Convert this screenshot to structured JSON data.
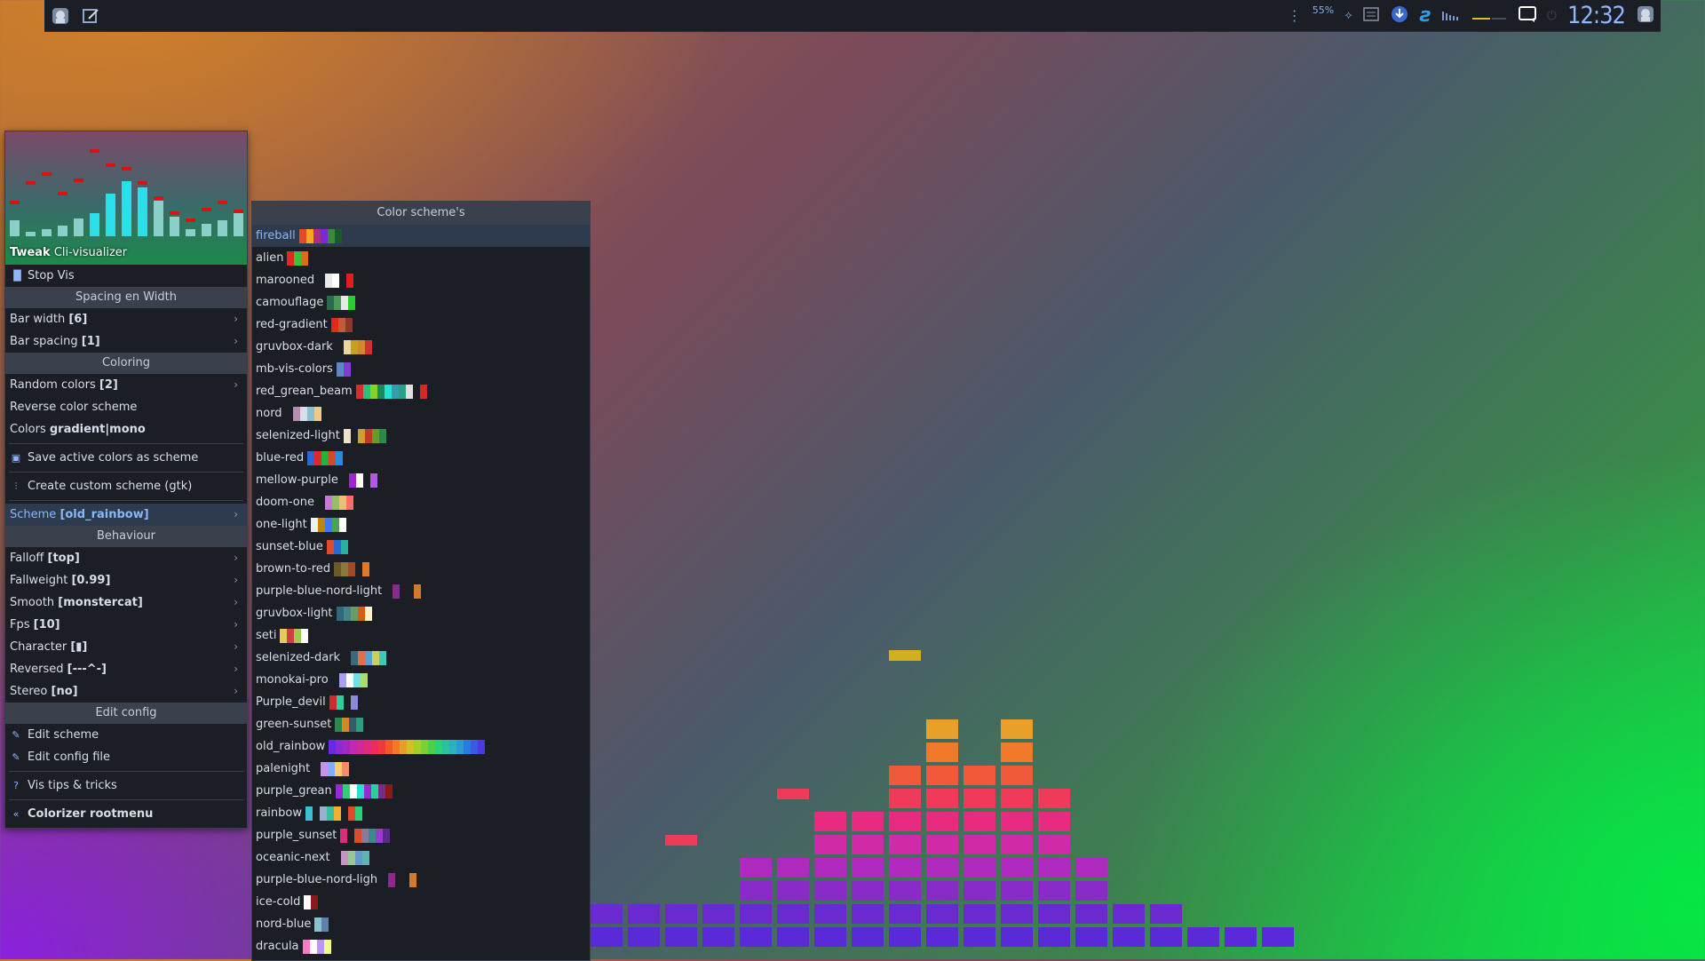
{
  "panel": {
    "battery_percent": "55%",
    "clock": "12:32",
    "icons": [
      "app-menu-icon",
      "editor-icon",
      "kebab-icon",
      "network-icon",
      "clipboard-icon",
      "update-icon",
      "script-icon",
      "volume-bars-icon",
      "battery-line-icon",
      "notification-icon",
      "power-icon",
      "user-icon"
    ]
  },
  "preview": {
    "title_bold": "Tweak",
    "title_rest": "Cli-visualizer"
  },
  "menu": {
    "stop_vis": "Stop Vis",
    "spacing_header": "Spacing en Width",
    "bar_width_label": "Bar width ",
    "bar_width_value": "[6]",
    "bar_spacing_label": "Bar spacing ",
    "bar_spacing_value": "[1]",
    "coloring_header": "Coloring",
    "random_colors_label": "Random colors ",
    "random_colors_value": "[2]",
    "reverse_scheme": "Reverse color scheme",
    "colors_label": "Colors ",
    "colors_value": "gradient|mono",
    "save_active": "Save active colors as scheme",
    "create_custom": "Create custom scheme (gtk)",
    "scheme_label": "Scheme ",
    "scheme_value": "[old_rainbow]",
    "behaviour_header": "Behaviour",
    "falloff_label": "Falloff ",
    "falloff_value": "[top]",
    "fallweight_label": "Fallweight ",
    "fallweight_value": "[0.99]",
    "smooth_label": "Smooth ",
    "smooth_value": "[monstercat]",
    "fps_label": "Fps ",
    "fps_value": "[10]",
    "character_label": "Character ",
    "character_value": "[▮]",
    "reversed_label": "Reversed ",
    "reversed_value": "[---^-]",
    "stereo_label": "Stereo ",
    "stereo_value": "[no]",
    "edit_config_header": "Edit config",
    "edit_scheme": "Edit scheme",
    "edit_config_file": "Edit config file",
    "vis_tips": "Vis tips & tricks",
    "colorizer_label": "Colorizer rootmenu"
  },
  "submenu": {
    "header": "Color scheme's",
    "schemes": [
      {
        "name": "fireball",
        "colors": [
          "#e34a2a",
          "#f5a623",
          "#b02a8a",
          "#7a2ad0",
          "#3a8a3a",
          "#1a5a2a"
        ]
      },
      {
        "name": "alien",
        "colors": [
          "#e02a1a",
          "#3ac03a",
          "#e06a1a"
        ]
      },
      {
        "name": "marooned",
        "colors": [
          "#1b1e24",
          "#e8e8e8",
          "#ffffff",
          "#1b1e24",
          "#e02020"
        ]
      },
      {
        "name": "camouflage",
        "colors": [
          "#2a6a4a",
          "#4a9a5a",
          "#e8e8e8",
          "#2ad02a"
        ]
      },
      {
        "name": "red-gradient",
        "colors": [
          "#e02a1a",
          "#c05a3a",
          "#8a3a2a"
        ]
      },
      {
        "name": "gruvbox-dark",
        "colors": [
          "#1b1e24",
          "#e8d8a0",
          "#c8a020",
          "#d08a2a",
          "#d03030"
        ]
      },
      {
        "name": "mb-vis-colors",
        "colors": [
          "#5a8ac0",
          "#8a3ad0"
        ]
      },
      {
        "name": "red_grean_beam",
        "colors": [
          "#d03030",
          "#2ac07a",
          "#8ad02a",
          "#1a8a5a",
          "#2ae0d0",
          "#3a9ab0",
          "#2aa08a",
          "#e0e0e0",
          "#1b1e24",
          "#d02a2a"
        ]
      },
      {
        "name": "nord",
        "colors": [
          "#1b1e24",
          "#b48ead",
          "#d8dee9",
          "#88c0d0",
          "#ebcb8b"
        ]
      },
      {
        "name": "selenized-light",
        "colors": [
          "#ece3cc",
          "#1b1e24",
          "#d2a02a",
          "#c03a2a",
          "#6a9a2a",
          "#2a8a4a"
        ]
      },
      {
        "name": "blue-red",
        "colors": [
          "#2a6ad0",
          "#e02a2a",
          "#2ab03a",
          "#d04a2a",
          "#2a8ae0"
        ]
      },
      {
        "name": "mellow-purple",
        "colors": [
          "#1b1e24",
          "#9a2ad0",
          "#ffffff",
          "#1b1e24",
          "#b05ae0"
        ]
      },
      {
        "name": "doom-one",
        "colors": [
          "#1b1e24",
          "#c678dd",
          "#98be65",
          "#ecbe7b",
          "#ff6c6b"
        ]
      },
      {
        "name": "one-light",
        "colors": [
          "#f0f0f0",
          "#c18401",
          "#4078f2",
          "#50a14f",
          "#ffffff"
        ]
      },
      {
        "name": "sunset-blue",
        "colors": [
          "#e04a2a",
          "#2a6ad0",
          "#2ab0a0"
        ]
      },
      {
        "name": "brown-to-red",
        "colors": [
          "#6a5a2a",
          "#8a7a3a",
          "#a04a2a",
          "#1b1e24",
          "#e07a2a"
        ]
      },
      {
        "name": "purple-blue-nord-light",
        "colors": [
          "#1b1e24",
          "#8a2a8a",
          "#1b1e24",
          "#1b1e24",
          "#d07a2a"
        ]
      },
      {
        "name": "gruvbox-light",
        "colors": [
          "#2a6a7a",
          "#458588",
          "#689d6a",
          "#d65d0e",
          "#fbf1c7"
        ]
      },
      {
        "name": "seti",
        "colors": [
          "#e8c85a",
          "#cd3f45",
          "#9fca56",
          "#ffffff"
        ]
      },
      {
        "name": "selenized-dark",
        "colors": [
          "#1b1e24",
          "#3a6a7a",
          "#e0704a",
          "#58a0d0",
          "#c8d060",
          "#41c7b9"
        ]
      },
      {
        "name": "monokai-pro",
        "colors": [
          "#1b1e24",
          "#ab9df2",
          "#ffffff",
          "#78dce8",
          "#a9dc76"
        ]
      },
      {
        "name": "Purple_devil",
        "colors": [
          "#d02a2a",
          "#2ad0a0",
          "#1b1e24",
          "#8a8ae0"
        ]
      },
      {
        "name": "green-sunset",
        "colors": [
          "#2a8a4a",
          "#d08a2a",
          "#3a5a6a",
          "#2aa07a"
        ]
      },
      {
        "name": "old_rainbow",
        "colors": [
          "#6a2ae0",
          "#8a2ad0",
          "#a02ac0",
          "#c02ab0",
          "#d02a9a",
          "#e02a7a",
          "#f02a5a",
          "#f03a3a",
          "#f05a2a",
          "#f07a2a",
          "#e0a02a",
          "#d0c02a",
          "#a0d02a",
          "#7ad03a",
          "#4ad04a",
          "#2ad07a",
          "#2ac0a0",
          "#2ab0c0",
          "#2a9ad0",
          "#2a7ae0",
          "#3a5ae0",
          "#4a3ae0"
        ]
      },
      {
        "name": "palenight",
        "colors": [
          "#1b1e24",
          "#c792ea",
          "#82aaff",
          "#ffcb6b",
          "#f78c6c"
        ]
      },
      {
        "name": "purple_grean",
        "colors": [
          "#9a2ad0",
          "#2ad07a",
          "#ffffff",
          "#2ae0d0",
          "#9a2ad0",
          "#2ad0a0",
          "#7a2a8a",
          "#8a1a1a"
        ]
      },
      {
        "name": "rainbow",
        "colors": [
          "#3ac0d0",
          "#1b1e24",
          "#9ab0d0",
          "#3ac0a0",
          "#f0b02a",
          "#1b1e24",
          "#e04a2a",
          "#2ad07a"
        ]
      },
      {
        "name": "purple_sunset",
        "colors": [
          "#e02a7a",
          "#1b1e24",
          "#e04a2a",
          "#8a7a9a",
          "#3a8a8a",
          "#9a3ad0",
          "#5a2a8a"
        ]
      },
      {
        "name": "oceanic-next",
        "colors": [
          "#1b1e24",
          "#c594c5",
          "#99c794",
          "#6699cc",
          "#5fb3b3"
        ]
      },
      {
        "name": "purple-blue-nord-ligh",
        "colors": [
          "#1b1e24",
          "#8a2a8a",
          "#1b1e24",
          "#1b1e24",
          "#d07a2a"
        ]
      },
      {
        "name": "ice-cold",
        "colors": [
          "#ffffff",
          "#8a1a1a"
        ]
      },
      {
        "name": "nord-blue",
        "colors": [
          "#88c0d0",
          "#5e81ac"
        ]
      },
      {
        "name": "dracula",
        "colors": [
          "#ff79c6",
          "#ffffff",
          "#bd93f9",
          "#f1fa8c"
        ]
      }
    ]
  }
}
